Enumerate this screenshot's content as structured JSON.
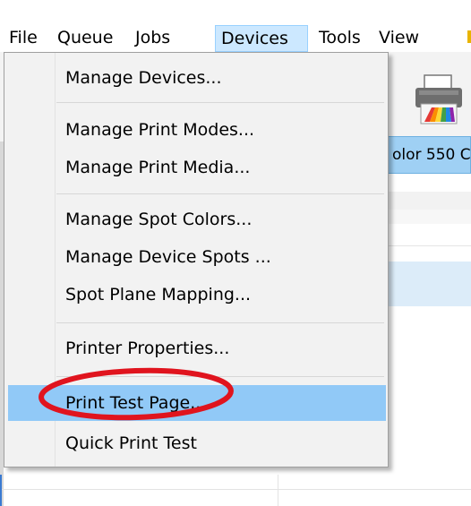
{
  "menubar": {
    "items": [
      {
        "label": "File"
      },
      {
        "label": "Queue"
      },
      {
        "label": "Jobs"
      },
      {
        "label": "Devices",
        "active": true
      },
      {
        "label": "Tools"
      },
      {
        "label": "View"
      }
    ]
  },
  "background": {
    "device_tab_label": "olor 550 C"
  },
  "devices_menu": {
    "items": [
      {
        "label": "Manage Devices..."
      },
      {
        "label": "Manage Print Modes..."
      },
      {
        "label": "Manage Print Media..."
      },
      {
        "label": "Manage Spot Colors..."
      },
      {
        "label": "Manage Device Spots ..."
      },
      {
        "label": "Spot Plane Mapping..."
      },
      {
        "label": "Printer Properties..."
      },
      {
        "label": "Print Test Page...",
        "highlighted": true
      },
      {
        "label": "Quick Print Test"
      }
    ]
  },
  "colors": {
    "menu_highlight": "#91c9f7",
    "active_menubar": "#cce8ff",
    "annotation": "#e0141e"
  },
  "icons": [
    "printer-icon"
  ]
}
